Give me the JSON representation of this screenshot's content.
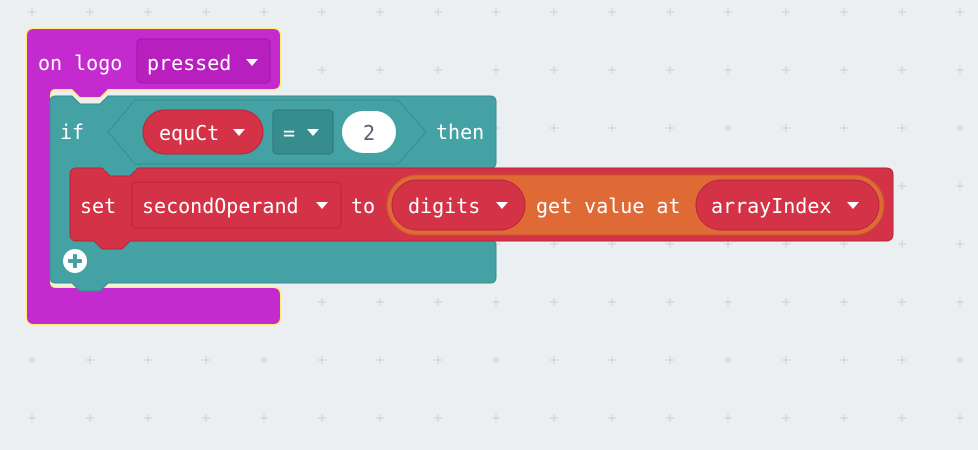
{
  "colors": {
    "background": "#ECEFF1",
    "grid": "#C9D1D6",
    "event_block": "#C42BCE",
    "event_dropdown": "#B71FBE",
    "event_outline": "#FFF176",
    "logic_block": "#44A2A4",
    "logic_dark": "#378C8E",
    "variable_block": "#D43247",
    "variable_dark": "#B8253A",
    "array_block": "#E06A35",
    "array_dark": "#C55A2A",
    "text_white": "#FFFFFF",
    "text_dark": "#575E75"
  },
  "event_block": {
    "label": "on logo",
    "dropdown_value": "pressed"
  },
  "if_block": {
    "if_label": "if",
    "then_label": "then",
    "condition": {
      "left_variable": "equCt",
      "operator": "=",
      "right_value": "2"
    },
    "add_icon": "plus-circle-icon"
  },
  "set_block": {
    "set_label": "set",
    "variable": "secondOperand",
    "to_label": "to",
    "array_get": {
      "array_variable": "digits",
      "label": "get value at",
      "index_variable": "arrayIndex"
    }
  },
  "icons": {
    "dropdown": "caret-down-icon",
    "plus": "plus-circle-icon"
  }
}
